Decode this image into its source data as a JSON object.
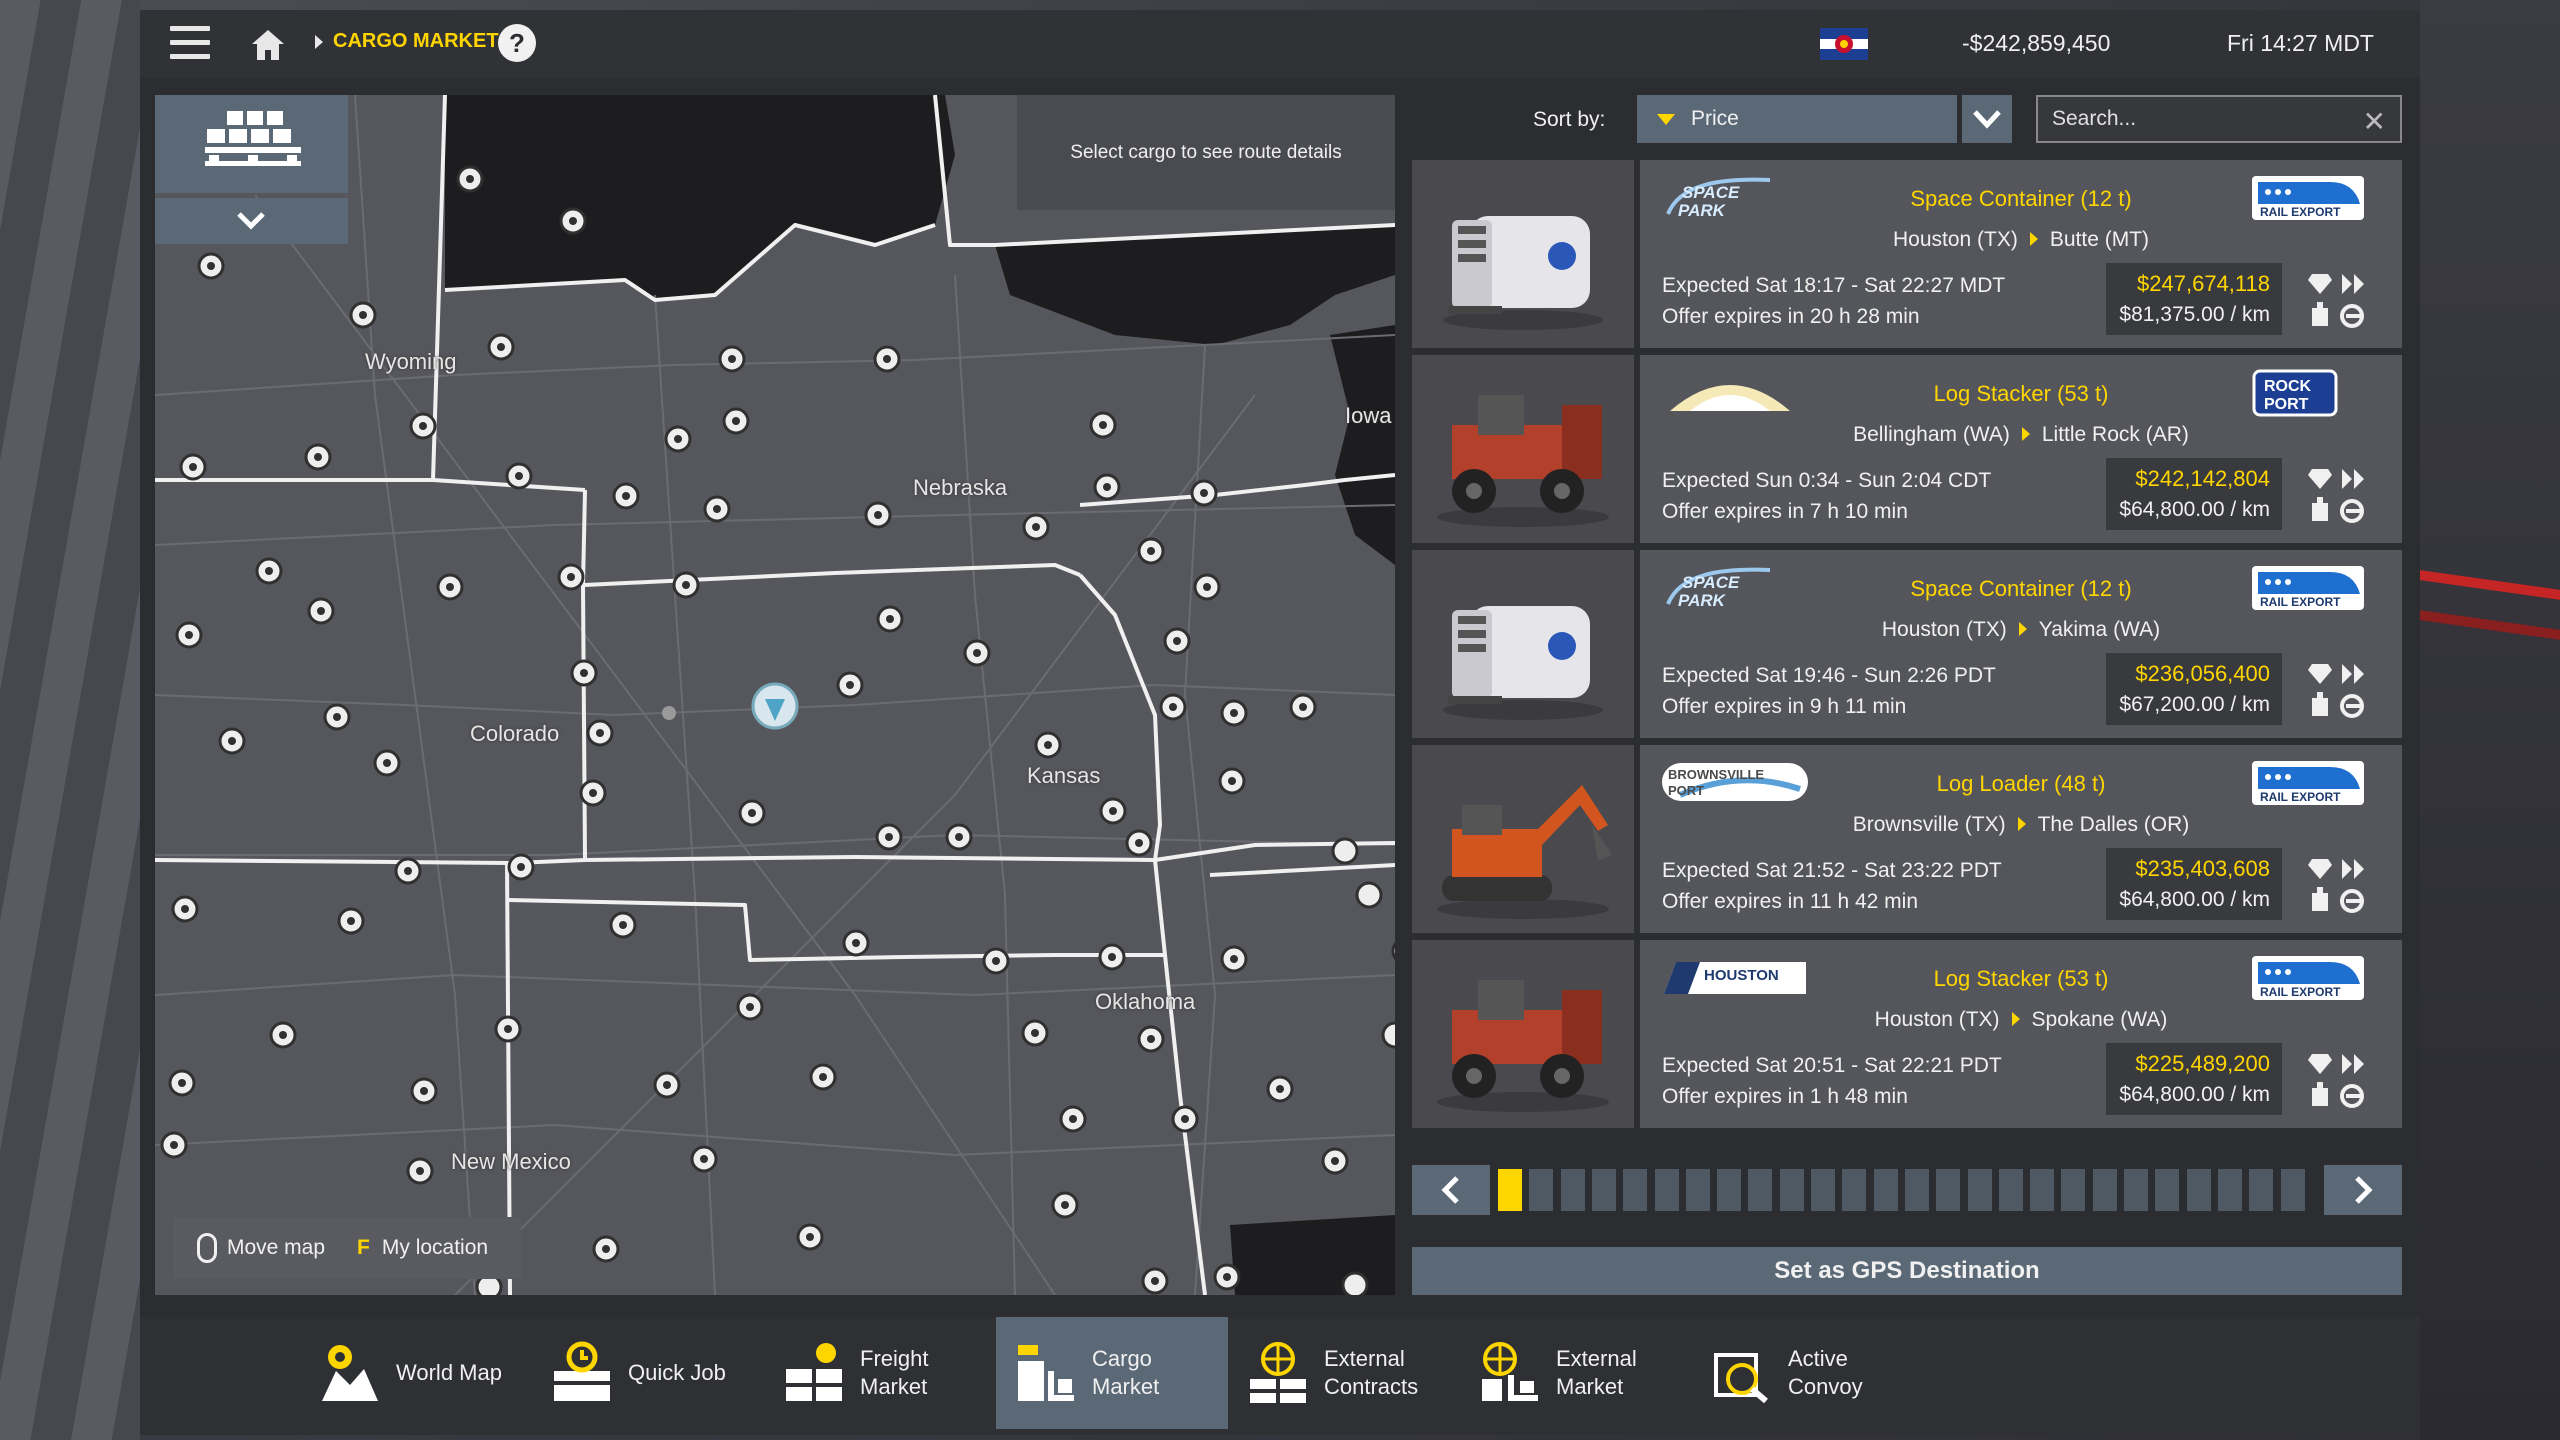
{
  "topbar": {
    "breadcrumb": "CARGO MARKET",
    "help": "?",
    "money": "-$242,859,450",
    "time": "Fri 14:27 MDT"
  },
  "map": {
    "route_hint": "Select cargo to see route details",
    "labels": {
      "wyoming": "Wyoming",
      "nebraska": "Nebraska",
      "iowa": "Iowa",
      "colorado": "Colorado",
      "kansas": "Kansas",
      "oklahoma": "Oklahoma",
      "new_mexico": "New Mexico"
    },
    "footer": {
      "move": "Move map",
      "key": "F",
      "location": "My location"
    }
  },
  "sort": {
    "label": "Sort by:",
    "value": "Price",
    "search_placeholder": "Search..."
  },
  "offers": [
    {
      "cargo": "Space Container (12 t)",
      "from": "Houston (TX)",
      "to": "Butte (MT)",
      "expected": "Expected Sat 18:17 - Sat 22:27 MDT",
      "offer": "Offer expires in 20 h 28 min",
      "price": "$247,674,118",
      "per_km": "$81,375.00 / km",
      "source_logo": "space-park-logo",
      "dest_logo": "rail-export-logo"
    },
    {
      "cargo": "Log Stacker (53 t)",
      "from": "Bellingham (WA)",
      "to": "Little Rock (AR)",
      "expected": "Expected Sun 0:34 - Sun 2:04 CDT",
      "offer": "Offer expires in 7 h 10 min",
      "price": "$242,142,804",
      "per_km": "$64,800.00 / km",
      "source_logo": "sunrise-logo",
      "dest_logo": "rock-port-logo"
    },
    {
      "cargo": "Space Container (12 t)",
      "from": "Houston (TX)",
      "to": "Yakima (WA)",
      "expected": "Expected Sat 19:46 - Sun 2:26 PDT",
      "offer": "Offer expires in 9 h 11 min",
      "price": "$236,056,400",
      "per_km": "$67,200.00 / km",
      "source_logo": "space-park-logo",
      "dest_logo": "rail-export-logo"
    },
    {
      "cargo": "Log Loader (48 t)",
      "from": "Brownsville (TX)",
      "to": "The Dalles (OR)",
      "expected": "Expected Sat 21:52 - Sat 23:22 PDT",
      "offer": "Offer expires in 11 h 42 min",
      "price": "$235,403,608",
      "per_km": "$64,800.00 / km",
      "source_logo": "brownsville-port-logo",
      "dest_logo": "rail-export-logo"
    },
    {
      "cargo": "Log Stacker (53 t)",
      "from": "Houston (TX)",
      "to": "Spokane (WA)",
      "expected": "Expected Sat 20:51 - Sat 22:21 PDT",
      "offer": "Offer expires in 1 h 48 min",
      "price": "$225,489,200",
      "per_km": "$64,800.00 / km",
      "source_logo": "houston-logo",
      "dest_logo": "rail-export-logo"
    }
  ],
  "pagination": {
    "pages": 26,
    "current": 1
  },
  "gps_button": "Set as GPS Destination",
  "nav": [
    {
      "label": "World Map",
      "icon": "world-map-icon"
    },
    {
      "label": "Quick Job",
      "icon": "quick-job-icon"
    },
    {
      "label": "Freight\nMarket",
      "icon": "freight-market-icon"
    },
    {
      "label": "Cargo\nMarket",
      "icon": "cargo-market-icon"
    },
    {
      "label": "External\nContracts",
      "icon": "external-contracts-icon"
    },
    {
      "label": "External\nMarket",
      "icon": "external-market-icon"
    },
    {
      "label": "Active\nConvoy",
      "icon": "active-convoy-icon"
    }
  ],
  "colors": {
    "accent": "#ffd500",
    "panel": "#5b6977",
    "bg": "#2c2d31"
  }
}
